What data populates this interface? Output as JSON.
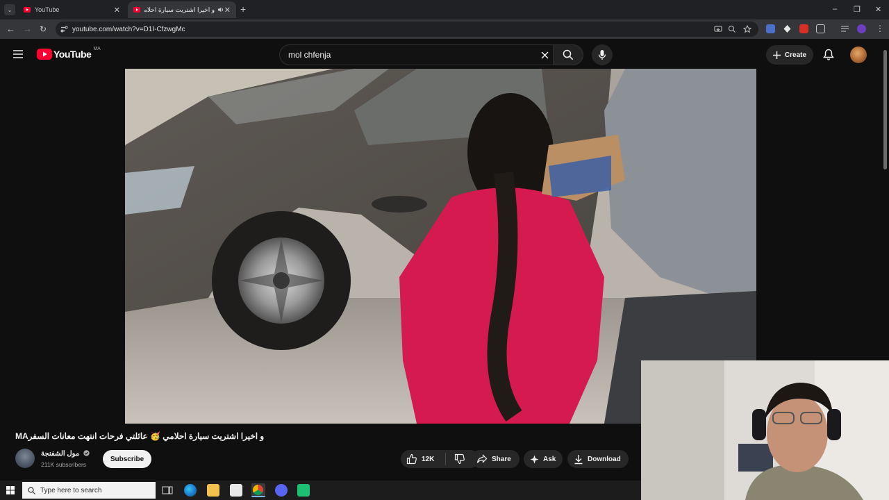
{
  "browser": {
    "tabs": [
      {
        "title": "YouTube",
        "active": false
      },
      {
        "title": "و اخيرا اشتريت سيارة احلامي",
        "active": true
      }
    ],
    "url": "youtube.com/watch?v=D1I-CfzwgMc",
    "new_tab_symbol": "+",
    "tab_close_symbol": "✕",
    "window_controls": [
      "–",
      "❐",
      "✕"
    ]
  },
  "youtube": {
    "logo_text": "YouTube",
    "country_code": "MA",
    "search_query": "mol chfenja",
    "create_label": "Create",
    "accent_color": "#ff0033"
  },
  "video": {
    "title": "و اخيرا اشتريت سيارة احلامي 🥳 عائلتي فرحات انتهت معانات السفرMA",
    "channel": "مول الشفنجة",
    "verified": true,
    "subscribers": "211K subscribers",
    "subscribe_label": "Subscribe",
    "likes": "12K",
    "share_label": "Share",
    "ask_label": "Ask",
    "download_label": "Download"
  },
  "taskbar": {
    "search_placeholder": "Type here to search"
  }
}
